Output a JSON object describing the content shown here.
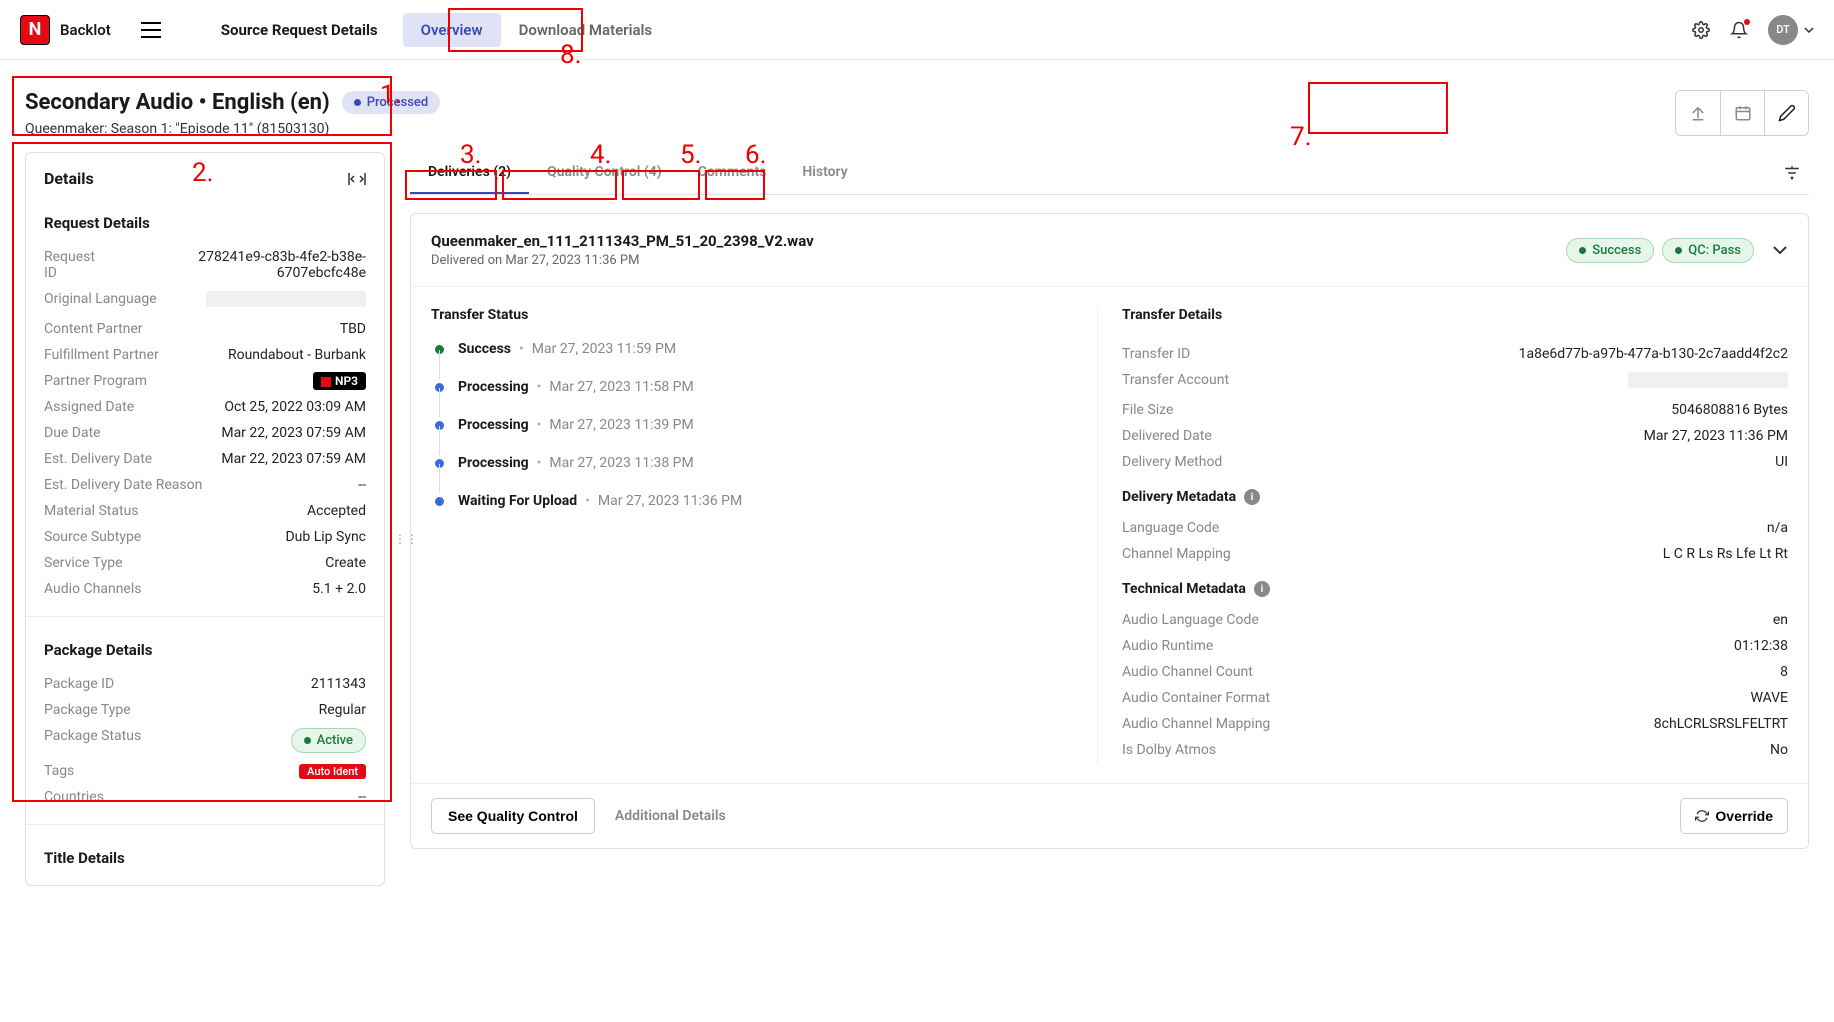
{
  "header": {
    "app_name": "Backlot",
    "title": "Source Request Details",
    "tabs": [
      {
        "label": "Overview",
        "active": true
      },
      {
        "label": "Download Materials",
        "active": false
      }
    ],
    "avatar_initials": "DT"
  },
  "page": {
    "title": "Secondary Audio • English (en)",
    "status": "Processed",
    "subtitle": "Queenmaker: Season 1: \"Episode 11\" (81503130)"
  },
  "details": {
    "card_title": "Details",
    "request_section": "Request Details",
    "request": [
      {
        "label": "Request ID",
        "value": "278241e9-c83b-4fe2-b38e-6707ebcfc48e"
      },
      {
        "label": "Original Language",
        "value": ""
      },
      {
        "label": "Content Partner",
        "value": "TBD"
      },
      {
        "label": "Fulfillment Partner",
        "value": "Roundabout - Burbank"
      },
      {
        "label": "Partner Program",
        "value": "NP3",
        "badge": "np3"
      },
      {
        "label": "Assigned Date",
        "value": "Oct 25, 2022 03:09 AM"
      },
      {
        "label": "Due Date",
        "value": "Mar 22, 2023 07:59 AM"
      },
      {
        "label": "Est. Delivery Date",
        "value": "Mar 22, 2023 07:59 AM"
      },
      {
        "label": "Est. Delivery Date Reason",
        "value": "--"
      },
      {
        "label": "Material Status",
        "value": "Accepted"
      },
      {
        "label": "Source Subtype",
        "value": "Dub Lip Sync"
      },
      {
        "label": "Service Type",
        "value": "Create"
      },
      {
        "label": "Audio Channels",
        "value": "5.1 + 2.0"
      }
    ],
    "package_section": "Package Details",
    "package": [
      {
        "label": "Package ID",
        "value": "2111343"
      },
      {
        "label": "Package Type",
        "value": "Regular"
      },
      {
        "label": "Package Status",
        "value": "Active",
        "pill": "active"
      },
      {
        "label": "Tags",
        "value": "Auto Ident",
        "tag": "auto"
      },
      {
        "label": "Countries",
        "value": "--"
      }
    ],
    "title_section": "Title Details"
  },
  "content_tabs": [
    {
      "label": "Deliveries (2)",
      "active": true
    },
    {
      "label": "Quality Control (4)",
      "active": false
    },
    {
      "label": "Comments",
      "active": false
    },
    {
      "label": "History",
      "active": false
    }
  ],
  "delivery": {
    "filename": "Queenmaker_en_111_2111343_PM_51_20_2398_V2.wav",
    "delivered_on": "Delivered on Mar 27, 2023 11:36 PM",
    "status_pill": "Success",
    "qc_pill": "QC: Pass",
    "transfer_status_title": "Transfer Status",
    "timeline": [
      {
        "status": "Success",
        "date": "Mar 27, 2023 11:59 PM",
        "dot": "success"
      },
      {
        "status": "Processing",
        "date": "Mar 27, 2023 11:58 PM",
        "dot": "processing"
      },
      {
        "status": "Processing",
        "date": "Mar 27, 2023 11:39 PM",
        "dot": "processing"
      },
      {
        "status": "Processing",
        "date": "Mar 27, 2023 11:38 PM",
        "dot": "processing"
      },
      {
        "status": "Waiting For Upload",
        "date": "Mar 27, 2023 11:36 PM",
        "dot": "processing"
      }
    ],
    "transfer_details_title": "Transfer Details",
    "transfer_details": [
      {
        "label": "Transfer ID",
        "value": "1a8e6d77b-a97b-477a-b130-2c7aadd4f2c2"
      },
      {
        "label": "Transfer Account",
        "value": ""
      },
      {
        "label": "File Size",
        "value": "5046808816 Bytes"
      },
      {
        "label": "Delivered Date",
        "value": "Mar 27, 2023 11:36 PM"
      },
      {
        "label": "Delivery Method",
        "value": "UI"
      }
    ],
    "delivery_metadata_title": "Delivery Metadata",
    "delivery_metadata": [
      {
        "label": "Language Code",
        "value": "n/a"
      },
      {
        "label": "Channel Mapping",
        "value": "L C R Ls Rs Lfe Lt Rt"
      }
    ],
    "technical_metadata_title": "Technical Metadata",
    "technical_metadata": [
      {
        "label": "Audio Language Code",
        "value": "en"
      },
      {
        "label": "Audio Runtime",
        "value": "01:12:38"
      },
      {
        "label": "Audio Channel Count",
        "value": "8"
      },
      {
        "label": "Audio Container Format",
        "value": "WAVE"
      },
      {
        "label": "Audio Channel Mapping",
        "value": "8chLCRLSRSLFELTRT"
      },
      {
        "label": "Is Dolby Atmos",
        "value": "No"
      }
    ],
    "footer": {
      "see_qc": "See Quality Control",
      "additional": "Additional Details",
      "override": "Override"
    }
  },
  "annotations": [
    "1.",
    "2.",
    "3.",
    "4.",
    "5.",
    "6.",
    "7.",
    "8."
  ]
}
